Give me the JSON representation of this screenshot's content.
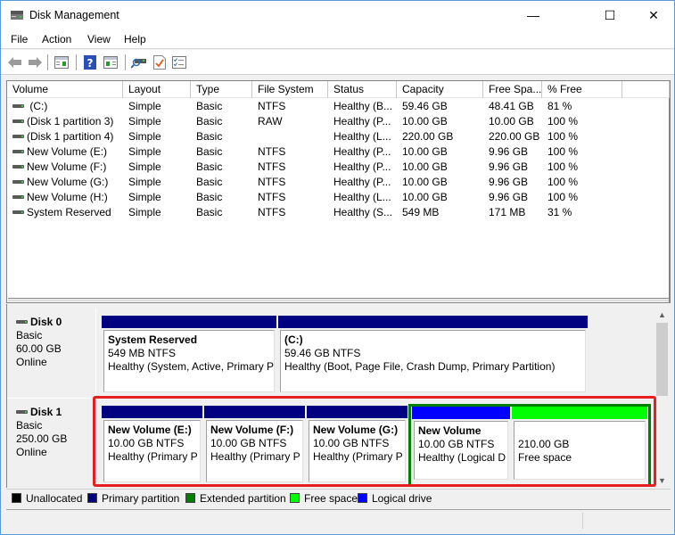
{
  "window": {
    "title": "Disk Management",
    "controls": {
      "minimize": "—",
      "maximize": "☐",
      "close": "✕"
    }
  },
  "menu": [
    "File",
    "Action",
    "View",
    "Help"
  ],
  "toolbar": {
    "buttons": [
      "back-icon",
      "forward-icon",
      "show-hide-console-tree-icon",
      "help-icon",
      "show-hide-action-pane-icon",
      "connect-disk-icon",
      "properties-icon",
      "checklist-icon"
    ]
  },
  "volume_list": {
    "columns": [
      "Volume",
      "Layout",
      "Type",
      "File System",
      "Status",
      "Capacity",
      "Free Spa...",
      "% Free"
    ],
    "rows": [
      {
        "volume": " (C:)",
        "layout": "Simple",
        "type": "Basic",
        "fs": "NTFS",
        "status": "Healthy (B...",
        "capacity": "59.46 GB",
        "free": "48.41 GB",
        "pct": "81 %"
      },
      {
        "volume": "(Disk 1 partition 3)",
        "layout": "Simple",
        "type": "Basic",
        "fs": "RAW",
        "status": "Healthy (P...",
        "capacity": "10.00 GB",
        "free": "10.00 GB",
        "pct": "100 %"
      },
      {
        "volume": "(Disk 1 partition 4)",
        "layout": "Simple",
        "type": "Basic",
        "fs": "",
        "status": "Healthy (L...",
        "capacity": "220.00 GB",
        "free": "220.00 GB",
        "pct": "100 %"
      },
      {
        "volume": "New Volume (E:)",
        "layout": "Simple",
        "type": "Basic",
        "fs": "NTFS",
        "status": "Healthy (P...",
        "capacity": "10.00 GB",
        "free": "9.96 GB",
        "pct": "100 %"
      },
      {
        "volume": "New Volume (F:)",
        "layout": "Simple",
        "type": "Basic",
        "fs": "NTFS",
        "status": "Healthy (P...",
        "capacity": "10.00 GB",
        "free": "9.96 GB",
        "pct": "100 %"
      },
      {
        "volume": "New Volume (G:)",
        "layout": "Simple",
        "type": "Basic",
        "fs": "NTFS",
        "status": "Healthy (P...",
        "capacity": "10.00 GB",
        "free": "9.96 GB",
        "pct": "100 %"
      },
      {
        "volume": "New Volume (H:)",
        "layout": "Simple",
        "type": "Basic",
        "fs": "NTFS",
        "status": "Healthy (L...",
        "capacity": "10.00 GB",
        "free": "9.96 GB",
        "pct": "100 %"
      },
      {
        "volume": "System Reserved",
        "layout": "Simple",
        "type": "Basic",
        "fs": "NTFS",
        "status": "Healthy (S...",
        "capacity": "549 MB",
        "free": "171 MB",
        "pct": "31 %"
      }
    ]
  },
  "disks": [
    {
      "name": "Disk 0",
      "type": "Basic",
      "size": "60.00 GB",
      "state": "Online",
      "partitions": [
        {
          "title": "System Reserved",
          "size": "549 MB NTFS",
          "status": "Healthy (System, Active, Primary P",
          "kind": "primary"
        },
        {
          "title": " (C:)",
          "size": "59.46 GB NTFS",
          "status": "Healthy (Boot, Page File, Crash Dump, Primary Partition)",
          "kind": "primary"
        }
      ]
    },
    {
      "name": "Disk 1",
      "type": "Basic",
      "size": "250.00 GB",
      "state": "Online",
      "partitions": [
        {
          "title": "New Volume  (E:)",
          "size": "10.00 GB NTFS",
          "status": "Healthy (Primary P",
          "kind": "primary"
        },
        {
          "title": "New Volume  (F:)",
          "size": "10.00 GB NTFS",
          "status": "Healthy (Primary P",
          "kind": "primary"
        },
        {
          "title": "New Volume  (G:)",
          "size": "10.00 GB NTFS",
          "status": "Healthy (Primary P",
          "kind": "primary"
        },
        {
          "title": "New Volume",
          "size": "10.00 GB NTFS",
          "status": "Healthy (Logical D",
          "kind": "logical"
        },
        {
          "title": "",
          "size": "210.00 GB",
          "status": "Free space",
          "kind": "free"
        }
      ]
    }
  ],
  "legend": [
    {
      "label": "Unallocated",
      "color": "#000000"
    },
    {
      "label": "Primary partition",
      "color": "#000080"
    },
    {
      "label": "Extended partition",
      "color": "#008000"
    },
    {
      "label": "Free space",
      "color": "#00ff00"
    },
    {
      "label": "Logical drive",
      "color": "#0000ff"
    }
  ],
  "colors": {
    "primary": "#000080",
    "logical": "#0000ff",
    "free": "#00ff00",
    "extended": "#008000",
    "highlight": "#e62020"
  }
}
